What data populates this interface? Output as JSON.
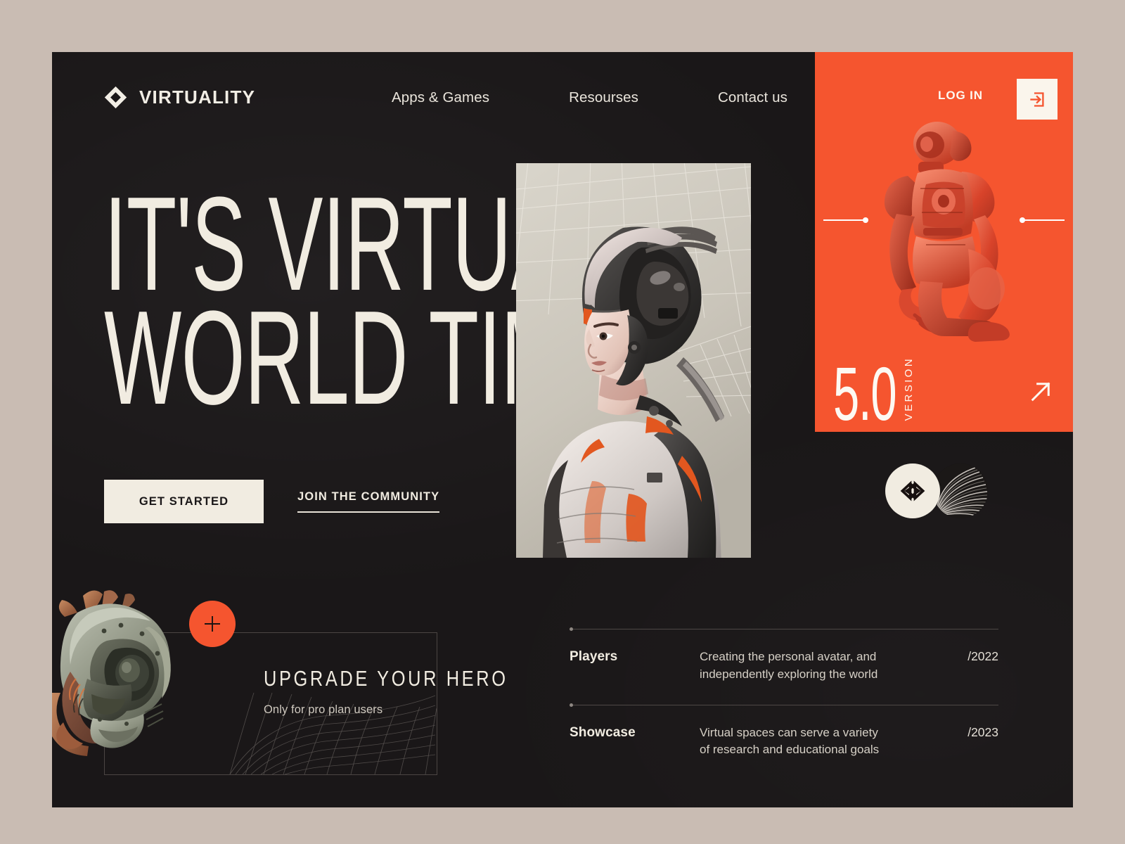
{
  "theme": {
    "page_background": "#c9bcb3",
    "panel_background": "#1a1718",
    "accent_orange": "#f5552f",
    "cream": "#f1ece1"
  },
  "header": {
    "brand_name": "VIRTUALITY",
    "brand_icon": "diamond-logo-icon",
    "nav": [
      {
        "label": "Apps & Games"
      },
      {
        "label": "Resourses"
      },
      {
        "label": "Contact us"
      }
    ]
  },
  "promo": {
    "login_label": "LOG IN",
    "login_icon": "login-arrow-icon",
    "version_number": "5.0",
    "version_label": "VERSION",
    "arrow_icon": "arrow-up-right-icon",
    "robot_image_alt": "orange-crouching-robot"
  },
  "hero": {
    "headline_line_1": "IT'S VIRTUAL",
    "headline_line_2": "WORLD TIME",
    "primary_cta": "GET STARTED",
    "secondary_cta": "JOIN THE COMMUNITY",
    "image_alt": "cyborg-woman-helmet-portrait"
  },
  "badges": {
    "logo_icon": "interlocking-knot-logo-icon",
    "fan_icon": "radial-fan-pattern-icon"
  },
  "upgrade": {
    "title": "UPGRADE YOUR HERO",
    "subtitle": "Only for pro plan users",
    "plus_icon": "plus-icon",
    "image_alt": "mecha-robot-head"
  },
  "features": {
    "rows": [
      {
        "name": "Players",
        "description": "Creating the personal avatar, and independently exploring the world",
        "year": "/2022"
      },
      {
        "name": "Showcase",
        "description": "Virtual spaces can serve a variety of research and educational goals",
        "year": "/2023"
      }
    ]
  }
}
